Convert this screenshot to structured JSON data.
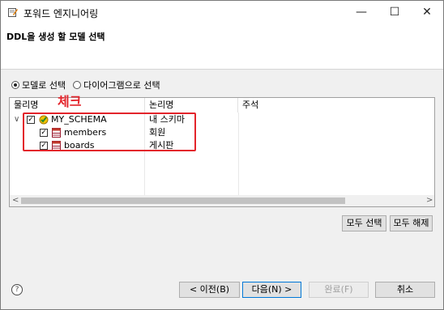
{
  "window": {
    "title": "포워드 엔지니어링",
    "min_glyph": "—",
    "max_glyph": "☐",
    "close_glyph": "✕"
  },
  "header": {
    "title": "DDL을 생성 할 모델 선택"
  },
  "options": [
    {
      "label": "모델로 선택",
      "selected": true
    },
    {
      "label": "다이어그램으로 선택",
      "selected": false
    }
  ],
  "table": {
    "columns": [
      "물리명",
      "논리명",
      "주석"
    ],
    "rows": [
      {
        "expander": "∨",
        "physical": "MY_SCHEMA",
        "logical": "내 스키마",
        "comment": "",
        "checked": true,
        "type": "schema"
      },
      {
        "expander": "",
        "physical": "members",
        "logical": "회원",
        "comment": "",
        "checked": true,
        "type": "table"
      },
      {
        "expander": "",
        "physical": "boards",
        "logical": "게시판",
        "comment": "",
        "checked": true,
        "type": "table"
      }
    ],
    "scroll_left": "<",
    "scroll_right": ">"
  },
  "annotation": {
    "label": "체크",
    "color": "#e3242b"
  },
  "selection_buttons": {
    "select_all": "모두 선택",
    "deselect_all": "모두 해제"
  },
  "footer": {
    "help": "?",
    "back": "< 이전(B)",
    "next": "다음(N) >",
    "finish": "완료(F)",
    "cancel": "취소"
  }
}
